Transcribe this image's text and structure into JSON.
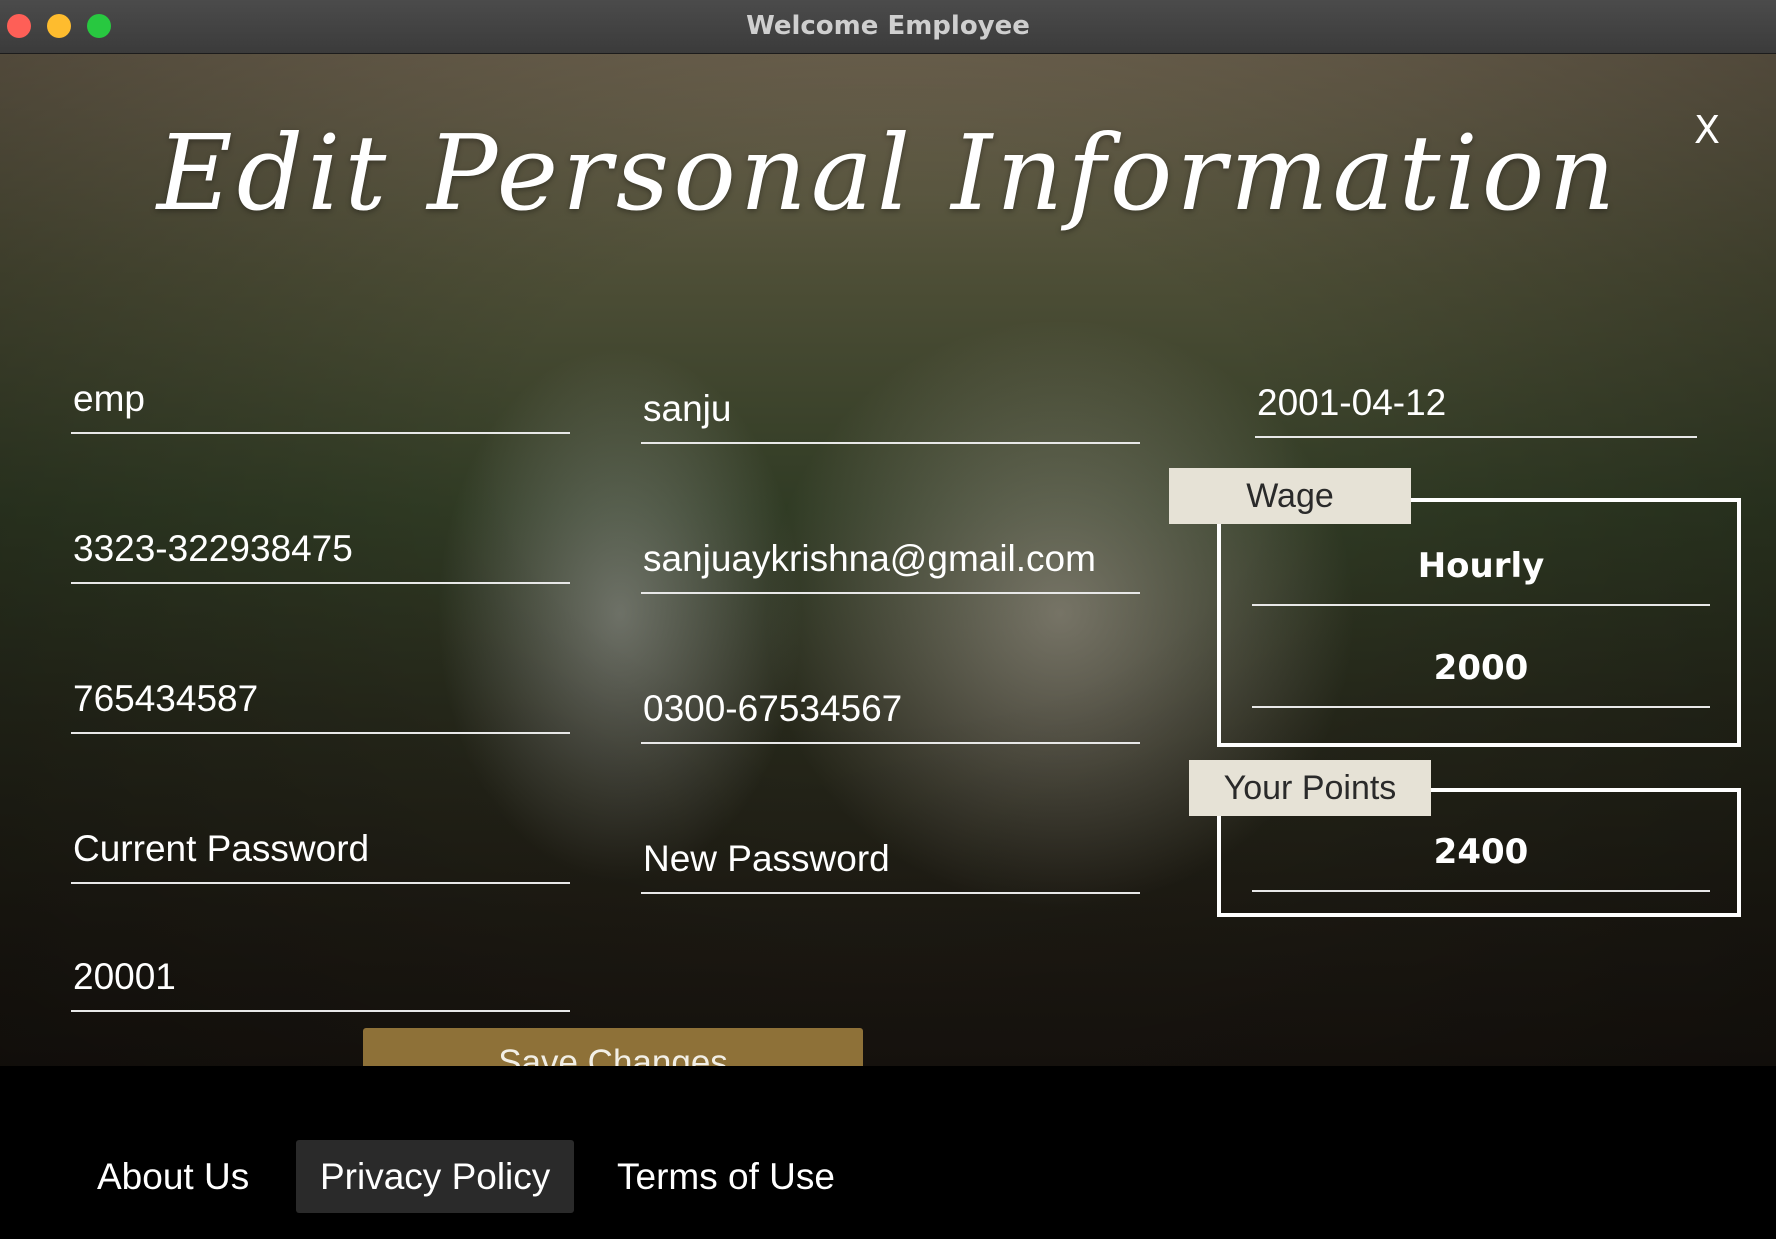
{
  "window": {
    "title": "Welcome Employee"
  },
  "heading": "Edit Personal Information",
  "close_label": "X",
  "fields": {
    "username": "emp",
    "first_name": "sanju",
    "dob": "2001-04-12",
    "cnic": "3323-322938475",
    "email": "sanjuaykrishna@gmail.com",
    "account_no": "765434587",
    "phone": "0300-67534567",
    "current_password_placeholder": "Current Password",
    "new_password_placeholder": "New Password",
    "zip": "20001"
  },
  "wage": {
    "tag": "Wage",
    "type": "Hourly",
    "amount": "2000"
  },
  "points": {
    "tag": "Your Points",
    "value": "2400"
  },
  "save_label": "Save Changes",
  "footer": {
    "links": [
      "About Us",
      "Privacy Policy",
      "Terms of Use"
    ],
    "active": "Privacy Policy"
  },
  "colors": {
    "button": "#8e7138",
    "tag_bg": "#e6e2d6",
    "footer_bg": "#000000"
  }
}
